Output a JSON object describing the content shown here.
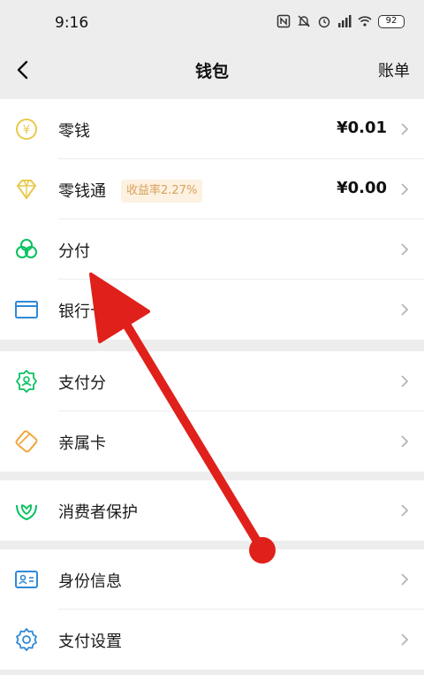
{
  "status_bar": {
    "time": "9:16",
    "battery": "92"
  },
  "nav": {
    "title": "钱包",
    "right_label": "账单"
  },
  "groups": [
    {
      "items": [
        {
          "label": "零钱",
          "value": "¥0.01",
          "icon": "coin-icon"
        },
        {
          "label": "零钱通",
          "value": "¥0.00",
          "badge": "收益率2.27%",
          "icon": "diamond-icon"
        },
        {
          "label": "分付",
          "icon": "circles-icon"
        },
        {
          "label": "银行卡",
          "icon": "bank-card-icon"
        }
      ]
    },
    {
      "items": [
        {
          "label": "支付分",
          "icon": "payscore-icon"
        },
        {
          "label": "亲属卡",
          "icon": "family-card-icon"
        }
      ]
    },
    {
      "items": [
        {
          "label": "消费者保护",
          "icon": "protect-hands-icon"
        }
      ]
    },
    {
      "items": [
        {
          "label": "身份信息",
          "icon": "id-card-icon"
        },
        {
          "label": "支付设置",
          "icon": "settings-gear-icon"
        }
      ]
    }
  ],
  "colors": {
    "accent_green": "#07c160",
    "coin_yellow": "#e8c94a",
    "annotation_red": "#e0201b"
  }
}
